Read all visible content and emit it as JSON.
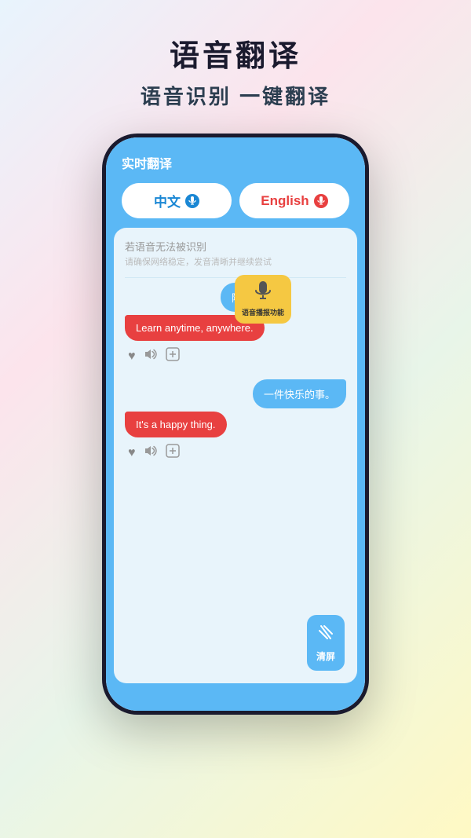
{
  "header": {
    "title": "语音翻译",
    "subtitle": "语音识别 一键翻译"
  },
  "app": {
    "top_bar_title": "实时翻译",
    "lang_chinese": "中文",
    "lang_english": "English",
    "error": {
      "title": "若语音无法被识别",
      "subtitle": "请确保网络稳定，发音清晰并继续尝试"
    },
    "messages": [
      {
        "source": "随时随地",
        "translation": "Learn anytime, anywhere."
      },
      {
        "source": "一件快乐的事。",
        "translation": "It's a happy thing."
      }
    ],
    "tooltip": {
      "icon": "🎤",
      "text": "语音播报功能"
    },
    "clear_button": "清屏"
  }
}
